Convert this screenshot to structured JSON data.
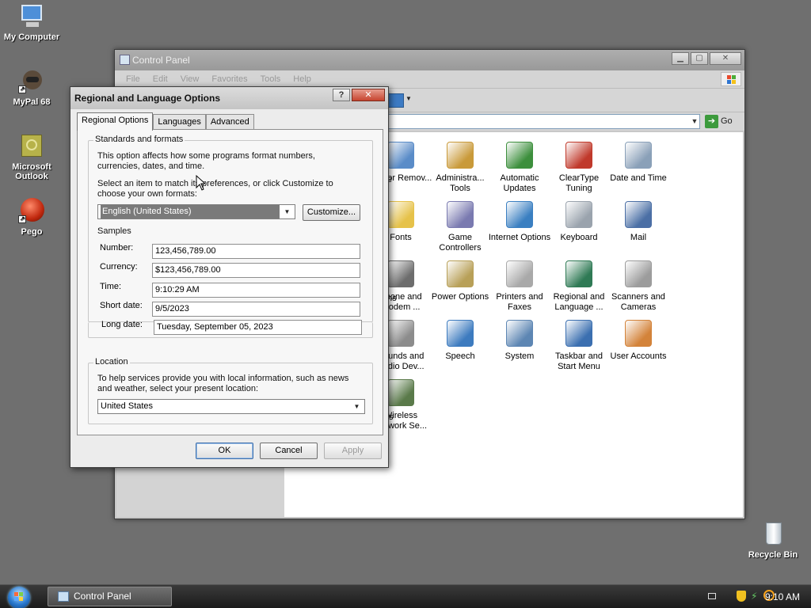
{
  "desktop": {
    "icons": [
      {
        "label": "My Computer"
      },
      {
        "label": "MyPal 68"
      },
      {
        "label": "Microsoft Outlook"
      },
      {
        "label": "Pego"
      },
      {
        "label": "Recycle Bin"
      }
    ]
  },
  "taskbar": {
    "task_label": "Control Panel",
    "clock": "9:10 AM"
  },
  "control_panel": {
    "title": "Control Panel",
    "menu": [
      "File",
      "Edit",
      "View",
      "Favorites",
      "Tools",
      "Help"
    ],
    "go_label": "Go",
    "partials": [
      "e",
      "ns",
      "s"
    ],
    "items": [
      {
        "label": "Add or Remov...",
        "icon": "add-remove-programs-icon",
        "color": "#5a8cc8"
      },
      {
        "label": "Administra... Tools",
        "icon": "administrative-tools-icon",
        "color": "#c99a3a"
      },
      {
        "label": "Automatic Updates",
        "icon": "windows-update-icon",
        "color": "#3d8f3d"
      },
      {
        "label": "ClearType Tuning",
        "icon": "cleartype-icon",
        "color": "#c0392b"
      },
      {
        "label": "Date and Time",
        "icon": "clock-icon",
        "color": "#8aa0b8"
      },
      {
        "label": "Fonts",
        "icon": "folder-fonts-icon",
        "color": "#e6c24a"
      },
      {
        "label": "Game Controllers",
        "icon": "gamepad-icon",
        "color": "#7a7ab0"
      },
      {
        "label": "Internet Options",
        "icon": "globe-icon",
        "color": "#3a7fc1"
      },
      {
        "label": "Keyboard",
        "icon": "keyboard-icon",
        "color": "#9aa3ad"
      },
      {
        "label": "Mail",
        "icon": "mail-icon",
        "color": "#4b6fa5"
      },
      {
        "label": "Phone and Modem ...",
        "icon": "phone-icon",
        "color": "#6d6d6d"
      },
      {
        "label": "Power Options",
        "icon": "power-icon",
        "color": "#b8a058"
      },
      {
        "label": "Printers and Faxes",
        "icon": "printer-icon",
        "color": "#a9a9a9"
      },
      {
        "label": "Regional and Language ...",
        "icon": "regional-globe-icon",
        "color": "#2f7a55"
      },
      {
        "label": "Scanners and Cameras",
        "icon": "scanner-icon",
        "color": "#9c9c9c"
      },
      {
        "label": "Sounds and Audio Dev...",
        "icon": "speaker-icon",
        "color": "#8c8c8c"
      },
      {
        "label": "Speech",
        "icon": "speech-icon",
        "color": "#3d7bbf"
      },
      {
        "label": "System",
        "icon": "system-icon",
        "color": "#5d86b3"
      },
      {
        "label": "Taskbar and Start Menu",
        "icon": "taskbar-icon",
        "color": "#3b6fb0"
      },
      {
        "label": "User Accounts",
        "icon": "users-icon",
        "color": "#d3833a"
      },
      {
        "label": "Wireless Network Se...",
        "icon": "wireless-icon",
        "color": "#5a7a4a"
      }
    ]
  },
  "dialog": {
    "title": "Regional and Language Options",
    "help_glyph": "?",
    "close_glyph": "✕",
    "tabs": [
      "Regional Options",
      "Languages",
      "Advanced"
    ],
    "standards": {
      "group_label": "Standards and formats",
      "desc1": "This option affects how some programs format numbers, currencies, dates, and time.",
      "desc2": "Select an item to match its preferences, or click Customize to choose your own formats:",
      "selected_format": "English (United States)",
      "customize_label": "Customize..."
    },
    "samples": {
      "group_label": "Samples",
      "rows": [
        {
          "label": "Number:",
          "value": "123,456,789.00"
        },
        {
          "label": "Currency:",
          "value": "$123,456,789.00"
        },
        {
          "label": "Time:",
          "value": "9:10:29 AM"
        },
        {
          "label": "Short date:",
          "value": "9/5/2023"
        },
        {
          "label": "Long date:",
          "value": "Tuesday, September 05, 2023"
        }
      ]
    },
    "location": {
      "group_label": "Location",
      "desc": "To help services provide you with local information, such as news and weather, select your present location:",
      "selected_location": "United States"
    },
    "buttons": {
      "ok": "OK",
      "cancel": "Cancel",
      "apply": "Apply"
    }
  }
}
